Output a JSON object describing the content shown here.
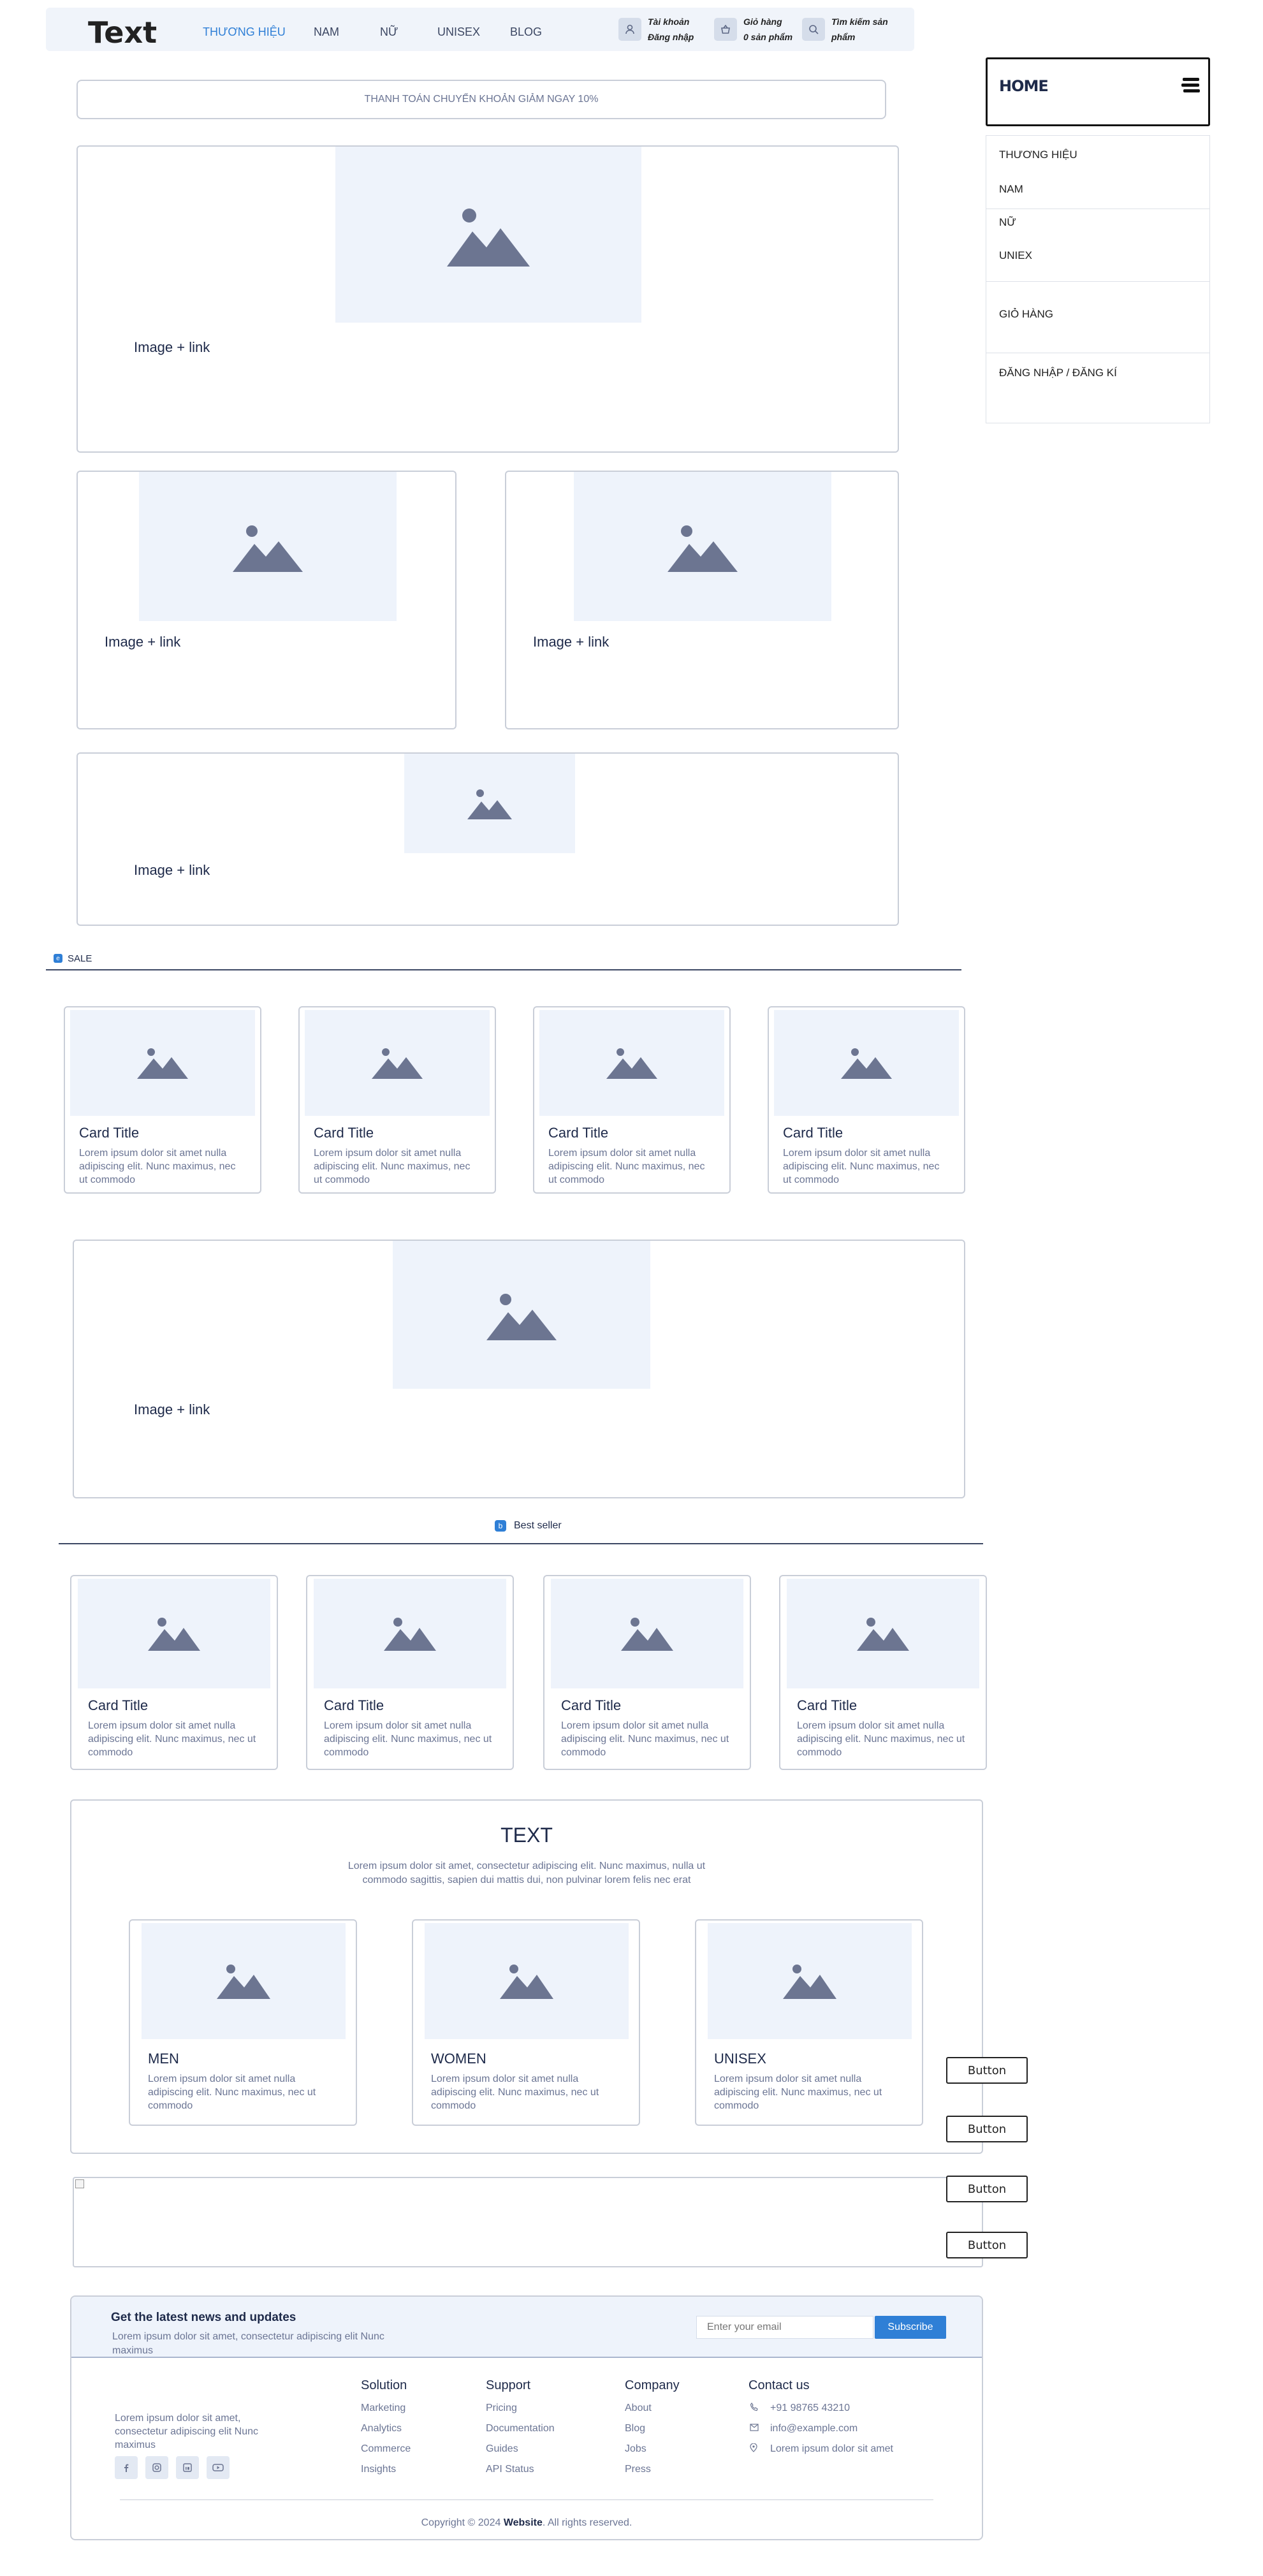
{
  "header": {
    "logo": "Text",
    "nav": [
      "THƯƠNG HIỆU",
      "NAM",
      "NỮ",
      "UNISEX",
      "BLOG"
    ],
    "account": {
      "line1": "Tài khoản",
      "line2": "Đăng nhập"
    },
    "cart": {
      "line1": "Giỏ hàng",
      "line2": "0 sản phẩm"
    },
    "search": {
      "line1": "Tìm kiếm sản",
      "line2": "phẩm"
    }
  },
  "side_menu": {
    "home": "HOME",
    "items": [
      "THƯƠNG HIỆU",
      "NAM",
      "NỮ",
      "UNIEX",
      "GIỎ HÀNG",
      "ĐĂNG NHẬP / ĐĂNG KÍ"
    ]
  },
  "promo": "THANH TOÁN CHUYỂN KHOẢN GIẢM NGAY 10%",
  "image_link": "Image + link",
  "sale": {
    "badge": "e",
    "label": "SALE"
  },
  "best": {
    "badge": "b",
    "label": "Best seller"
  },
  "card": {
    "title": "Card Title",
    "text": "Lorem ipsum dolor sit amet nulla adipiscing elit. Nunc maximus, nec ut commodo"
  },
  "category": {
    "title": "TEXT",
    "intro": "Lorem ipsum dolor sit amet, consectetur adipiscing elit. Nunc maximus, nulla ut commodo sagittis, sapien dui mattis dui, non pulvinar lorem felis nec erat",
    "items": [
      {
        "name": "MEN",
        "text": "Lorem ipsum dolor sit amet nulla adipiscing elit. Nunc maximus, nec ut commodo"
      },
      {
        "name": "WOMEN",
        "text": "Lorem ipsum dolor sit amet nulla adipiscing elit. Nunc maximus, nec ut commodo"
      },
      {
        "name": "UNISEX",
        "text": "Lorem ipsum dolor sit amet nulla adipiscing elit. Nunc maximus, nec ut commodo"
      }
    ]
  },
  "button_label": "Button",
  "footer": {
    "news_title": "Get the latest news and updates",
    "news_text": "Lorem ipsum dolor sit amet, consectetur adipiscing elit Nunc maximus",
    "email_placeholder": "Enter your email",
    "subscribe": "Subscribe",
    "about": "Lorem ipsum dolor sit amet, consectetur adipiscing elit Nunc maximus",
    "columns": [
      {
        "title": "Solution",
        "links": [
          "Marketing",
          "Analytics",
          "Commerce",
          "Insights"
        ]
      },
      {
        "title": "Support",
        "links": [
          "Pricing",
          "Documentation",
          "Guides",
          "API Status"
        ]
      },
      {
        "title": "Company",
        "links": [
          "About",
          "Blog",
          "Jobs",
          "Press"
        ]
      }
    ],
    "contact": {
      "title": "Contact us",
      "phone": "+91 98765 43210",
      "email": "info@example.com",
      "address": "Lorem ipsum dolor sit amet"
    },
    "copyright_pre": "Copyright © 2024 ",
    "copyright_site": "Website",
    "copyright_post": ". All rights reserved."
  },
  "colors": {
    "accent": "#2f7fd6",
    "placeholder_bg": "#eef3fb",
    "icon": "#6c7591",
    "text": "#1e2a4a"
  }
}
